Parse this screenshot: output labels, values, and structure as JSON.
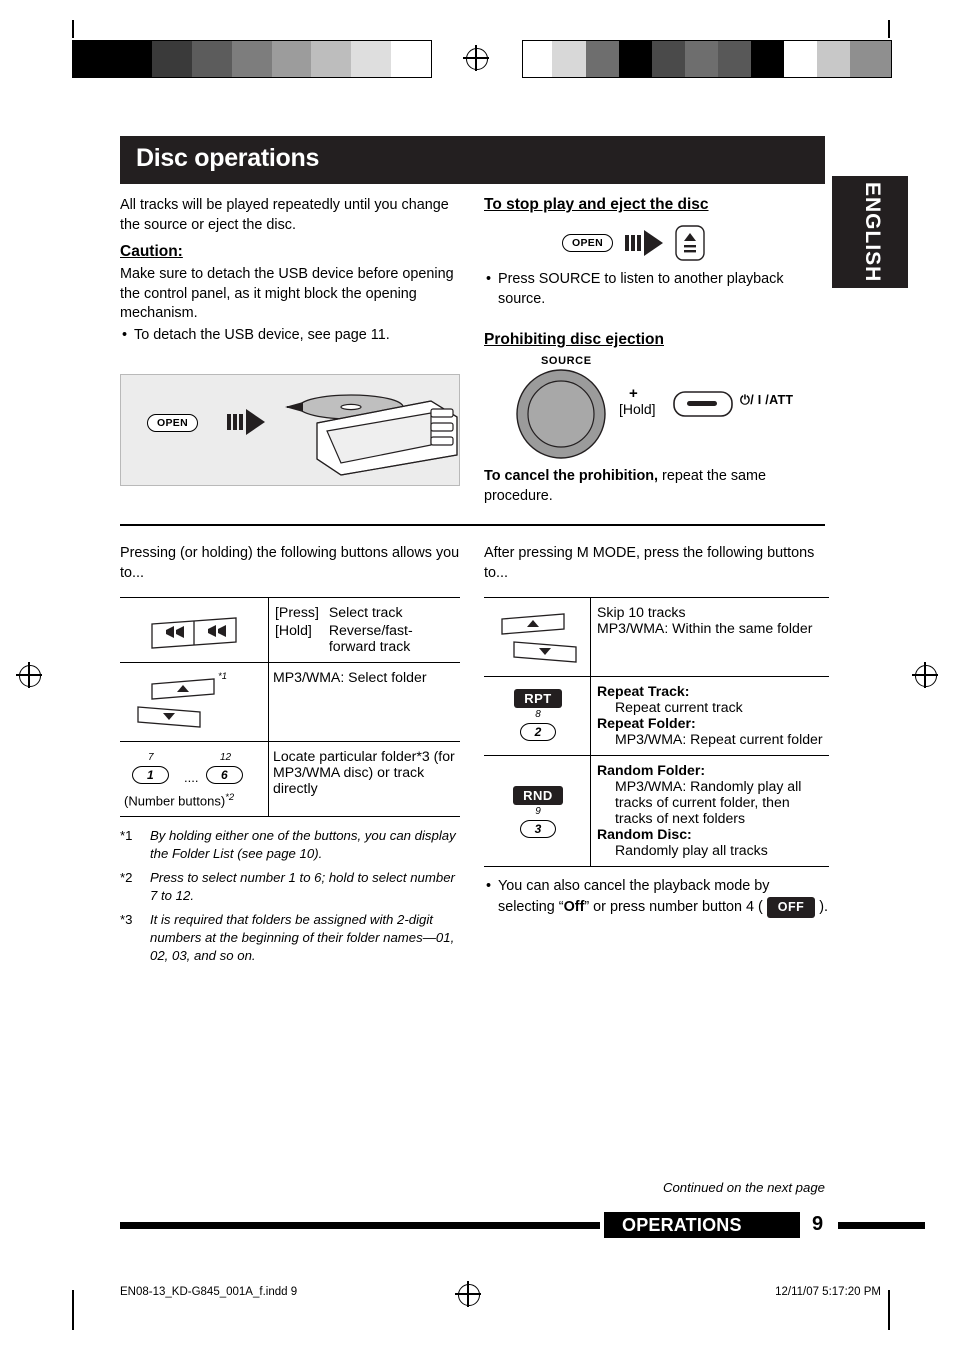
{
  "document": {
    "title": "Disc operations",
    "side_tab": "ENGLISH",
    "page_number": "9",
    "footer_section": "OPERATIONS",
    "continued": "Continued on the next page",
    "footer_file": "EN08-13_KD-G845_001A_f.indd   9",
    "footer_timestamp": "12/11/07   5:17:20 PM"
  },
  "left_column": {
    "intro": "All tracks will be played repeatedly until you change the source or eject the disc.",
    "caution_heading": "Caution:",
    "caution_body": "Make sure to detach the USB device before opening the control panel, as it might block the opening mechanism.",
    "caution_bullet": "To detach the USB device, see page 11.",
    "illustration_button": "OPEN"
  },
  "right_column": {
    "stop_heading": "To stop play and eject the disc",
    "stop_button": "OPEN",
    "stop_bullet": "Press SOURCE to listen to another playback source.",
    "prohibit_heading": "Prohibiting disc ejection",
    "source_label": "SOURCE",
    "plus": "+",
    "hold": "[Hold]",
    "att_label": "/ I /ATT",
    "cancel_bold": "To cancel the prohibition,",
    "cancel_rest": " repeat the same procedure."
  },
  "left_table": {
    "intro": "Pressing (or holding) the following buttons allows you to...",
    "rows": [
      {
        "icon": "track-rocker-button",
        "lines": [
          {
            "key": "[Press]",
            "val": "Select track"
          },
          {
            "key": "[Hold]",
            "val": "Reverse/fast-forward track"
          }
        ]
      },
      {
        "icon": "up-down-buttons",
        "footnote": "*1",
        "text": "MP3/WMA: Select folder"
      },
      {
        "icon": "number-buttons",
        "number_small_left": "7",
        "number_small_right": "12",
        "number_left": "1",
        "number_right": "6",
        "dots": "....",
        "caption": "(Number buttons)",
        "caption_footnote": "*2",
        "text": "Locate particular folder*3 (for MP3/WMA disc) or track directly"
      }
    ],
    "footnotes": [
      {
        "mark": "*1",
        "text": "By holding either one of the buttons, you can display the Folder List (see page 10)."
      },
      {
        "mark": "*2",
        "text": "Press to select number 1 to 6; hold to select number 7 to 12."
      },
      {
        "mark": "*3",
        "text": "It is required that folders be assigned with 2-digit numbers at the beginning of their folder names—01, 02, 03, and so on."
      }
    ]
  },
  "right_table": {
    "intro": "After pressing M MODE, press the following buttons to...",
    "rows": [
      {
        "icon": "up-down-buttons",
        "lines": [
          "Skip 10 tracks",
          "MP3/WMA: Within the same folder"
        ]
      },
      {
        "icon": "rpt-button",
        "badge": "RPT",
        "badge_small": "8",
        "num": "2",
        "items": [
          {
            "bold": "Repeat Track:",
            "sub": "Repeat current track"
          },
          {
            "bold": "Repeat Folder:",
            "sub": "MP3/WMA: Repeat current folder"
          }
        ]
      },
      {
        "icon": "rnd-button",
        "badge": "RND",
        "badge_small": "9",
        "num": "3",
        "items": [
          {
            "bold": "Random Folder:",
            "sub": "MP3/WMA: Randomly play all tracks of current folder, then tracks of next folders"
          },
          {
            "bold": "Random Disc:",
            "sub": "Randomly play all tracks"
          }
        ]
      }
    ],
    "bullet_pre": "You can also cancel the playback mode by selecting “",
    "bullet_bold": "Off",
    "bullet_mid": "” or press number button 4 ( ",
    "bullet_badge": "OFF",
    "bullet_post": " )."
  },
  "colors": {
    "ink": "#231f20",
    "panel": "#ececec"
  }
}
